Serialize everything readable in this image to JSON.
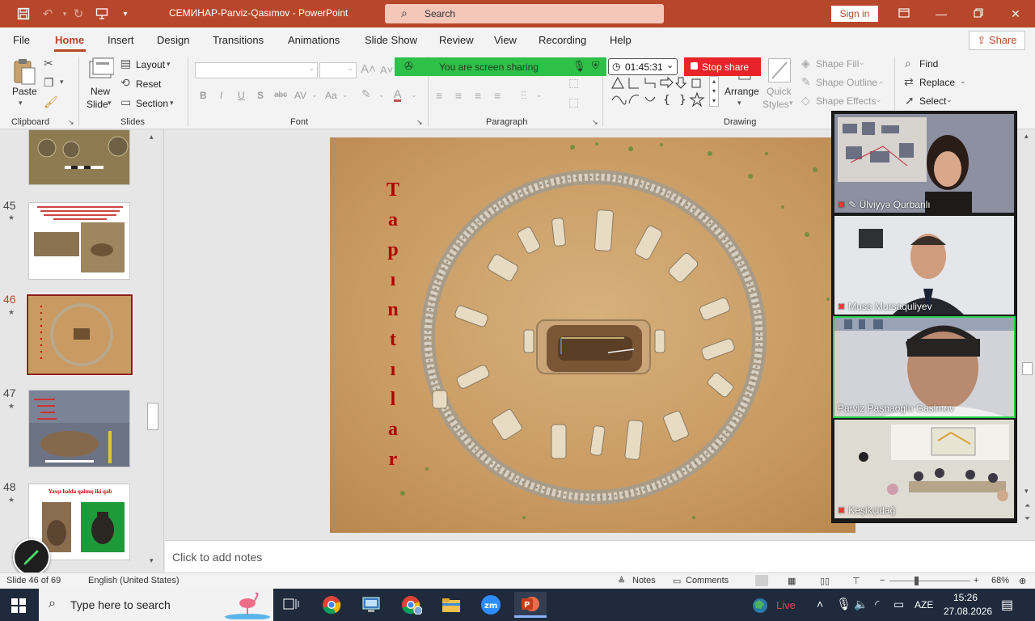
{
  "titlebar": {
    "doc_title": "СЕМИНАР-Parviz-Qasımov  -  PowerPoint",
    "search_label": "Search",
    "signin_label": "Sign in"
  },
  "menu": {
    "items": [
      "File",
      "Home",
      "Insert",
      "Design",
      "Transitions",
      "Animations",
      "Slide Show",
      "Review",
      "View",
      "Recording",
      "Help"
    ],
    "active": "Home",
    "share_label": "Share"
  },
  "ribbon": {
    "clipboard": {
      "paste": "Paste",
      "group": "Clipboard"
    },
    "slides": {
      "new_slide_1": "New",
      "new_slide_2": "Slide",
      "layout": "Layout",
      "reset": "Reset",
      "section": "Section",
      "group": "Slides"
    },
    "font": {
      "group": "Font",
      "bold": "B",
      "italic": "I",
      "underline": "U",
      "shadow": "S",
      "strike": "abc",
      "spacing": "AV",
      "case": "Aa",
      "font_color": "A"
    },
    "paragraph": {
      "group": "Paragraph"
    },
    "drawing": {
      "arrange": "Arrange",
      "quick_styles_1": "Quick",
      "quick_styles_2": "Styles",
      "shape_fill": "Shape Fill",
      "shape_outline": "Shape Outline",
      "shape_effects": "Shape Effects",
      "group": "Drawing"
    },
    "editing": {
      "find": "Find",
      "replace": "Replace",
      "select": "Select"
    }
  },
  "screen_share": {
    "status": "You are screen sharing",
    "timer": "01:45:31",
    "stop_label": "Stop share"
  },
  "thumbnails": [
    {
      "num": "45",
      "star": "★"
    },
    {
      "num": "46",
      "star": "★",
      "active": true
    },
    {
      "num": "47",
      "star": "★"
    },
    {
      "num": "48",
      "star": "★",
      "title": "Yaxşı halda qalmış iki qab"
    }
  ],
  "slide": {
    "vertical_title": [
      "T",
      "a",
      "p",
      "ı",
      "n",
      "t",
      "ı",
      "l",
      "a",
      "r"
    ]
  },
  "notes_placeholder": "Click to add notes",
  "video_tiles": [
    {
      "name": "Ülviyyə Qurbanlı"
    },
    {
      "name": "Musa Mursaquliyev"
    },
    {
      "name": "Parviz Pashaoglu Gasimov",
      "active": true
    },
    {
      "name": "Keşikçidağ"
    }
  ],
  "statusbar": {
    "slide_info": "Slide 46 of 69",
    "language": "English (United States)",
    "notes": "Notes",
    "comments": "Comments",
    "zoom": "68%"
  },
  "taskbar": {
    "search_placeholder": "Type here to search",
    "live": "Live",
    "lang": "AZE",
    "time": "15:26",
    "date": "27.08.2026"
  },
  "colors": {
    "accent": "#b7472a",
    "share_green": "#2fc04a",
    "stop_red": "#e8232a",
    "title_red": "#b00000"
  }
}
